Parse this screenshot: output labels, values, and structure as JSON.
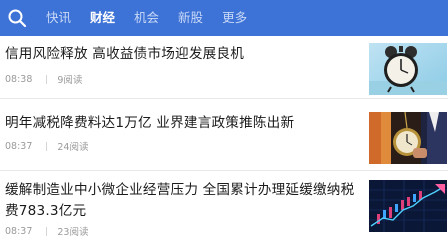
{
  "header": {
    "tabs": [
      {
        "label": "快讯",
        "active": false
      },
      {
        "label": "财经",
        "active": true
      },
      {
        "label": "机会",
        "active": false
      },
      {
        "label": "新股",
        "active": false
      },
      {
        "label": "更多",
        "active": false
      }
    ],
    "search_icon": "search-icon",
    "bg_color": "#3d72d6"
  },
  "news": [
    {
      "title": "信用风险释放 高收益债市场迎发展良机",
      "time": "08:38",
      "reads": "9阅读",
      "image": "alarm-clock-image"
    },
    {
      "title": "明年减税降费料达1万亿 业界建言政策推陈出新",
      "time": "08:37",
      "reads": "24阅读",
      "image": "pocket-watch-image"
    },
    {
      "title": "缓解制造业中小微企业经营压力 全国累计办理延缓缴纳税费783.3亿元",
      "time": "08:37",
      "reads": "23阅读",
      "image": "stock-chart-image"
    }
  ]
}
